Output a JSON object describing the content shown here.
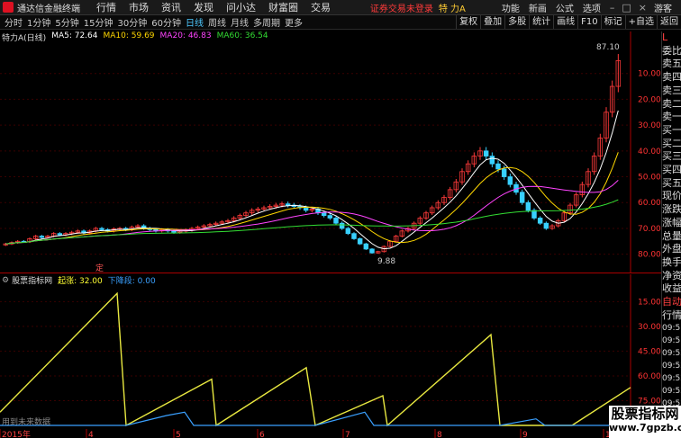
{
  "app": {
    "title": "通达信金融终端",
    "menus": [
      "行情",
      "市场",
      "资讯",
      "发现",
      "问小达",
      "财富圈",
      "交易"
    ],
    "login_status": "证券交易未登录",
    "stock_name": "特 力A",
    "right_menus": [
      "功能",
      "新画",
      "公式",
      "选项"
    ],
    "guest": "游客",
    "window_buttons": [
      "–",
      "□",
      "×"
    ]
  },
  "toolbar": {
    "periods": [
      "分时",
      "1分钟",
      "5分钟",
      "15分钟",
      "30分钟",
      "60分钟",
      "日线",
      "周线",
      "月线",
      "多周期",
      "更多"
    ],
    "active_period": "日线",
    "right_tools": [
      "复权",
      "叠加",
      "多股",
      "统计",
      "画线",
      "F10",
      "标记",
      "+自选",
      "返回"
    ]
  },
  "main_chart": {
    "title": "特力A(日线)",
    "ma": [
      {
        "label": "MA5: 72.64",
        "color": "#ffffff"
      },
      {
        "label": "MA10: 59.69",
        "color": "#ffd700"
      },
      {
        "label": "MA20: 46.83",
        "color": "#ff44ff"
      },
      {
        "label": "MA60: 36.54",
        "color": "#33dd33"
      }
    ],
    "y_ticks": [
      "80.00",
      "70.00",
      "60.00",
      "50.00",
      "40.00",
      "30.00",
      "20.00",
      "10.00"
    ],
    "high_label": "87.10",
    "low_label": "9.88",
    "marker": "定"
  },
  "indicator": {
    "name": "股票指标网",
    "line1": "起涨: 32.00",
    "line2": "下降段: 0.00",
    "y_ticks": [
      "75.00",
      "60.00",
      "45.00",
      "30.00",
      "15.00"
    ],
    "note": "用到未来数据"
  },
  "date_axis": {
    "labels": [
      "2015年",
      "4",
      "5",
      "6",
      "7",
      "8",
      "9",
      "10"
    ]
  },
  "right_panel": {
    "items": [
      "L",
      "委比",
      "卖五",
      "卖四",
      "卖三",
      "卖二",
      "卖一",
      "买一",
      "买二",
      "买三",
      "买四",
      "买五",
      "现价",
      "涨跌",
      "涨幅",
      "总量",
      "外盘",
      "换手",
      "净资",
      "收益",
      "自动",
      "行情",
      "09:51",
      "09:51",
      "09:52",
      "09:52",
      "09:52",
      "09:52",
      "09:52",
      "09:53",
      "09:53",
      "09:53"
    ]
  },
  "watermark": {
    "title": "股票指标网",
    "url": "www.7gpzb.com"
  },
  "chart_data": [
    {
      "type": "candlestick",
      "title": "特力A(日线)",
      "ylim": [
        5,
        90
      ],
      "y_ticks": [
        10,
        20,
        30,
        40,
        50,
        60,
        70,
        80
      ],
      "close": [
        14,
        14.5,
        15,
        14.8,
        16,
        17,
        16.5,
        17,
        18,
        17.5,
        18,
        18.5,
        19,
        18.2,
        19,
        20,
        19.5,
        19,
        19.8,
        20,
        19.5,
        20.5,
        21,
        20,
        19.5,
        19,
        19.5,
        19,
        18.5,
        19,
        19.3,
        20,
        20.5,
        21,
        21.5,
        22,
        22.5,
        23,
        24,
        25,
        26,
        27,
        27.5,
        28,
        28.5,
        29,
        29.5,
        29,
        28.5,
        28,
        27,
        27.5,
        26,
        25,
        24,
        22,
        20,
        18,
        16,
        14,
        12,
        10.5,
        11,
        13,
        15,
        17,
        19,
        20,
        22,
        24,
        26,
        28,
        30,
        32,
        35,
        38,
        42,
        45,
        48,
        50,
        48,
        45,
        43,
        40,
        37,
        34,
        30,
        27,
        24,
        22,
        20,
        21,
        23,
        26,
        29,
        33,
        37,
        42,
        48,
        55,
        65,
        75,
        85
      ]
    },
    {
      "type": "line",
      "title": "股票指标网",
      "ylim": [
        0,
        85
      ],
      "y_ticks": [
        15,
        30,
        45,
        60,
        75
      ],
      "series": [
        {
          "name": "起涨",
          "x": [
            0,
            130,
            140,
            235,
            240,
            340,
            350,
            425,
            430,
            545,
            555,
            625,
            635,
            700
          ],
          "values": [
            8,
            80,
            0,
            28,
            0,
            35,
            0,
            18,
            0,
            55,
            0,
            0,
            0,
            23
          ]
        },
        {
          "name": "下降段",
          "x": [
            0,
            130,
            140,
            185,
            205,
            215,
            235,
            350,
            405,
            415,
            545,
            555,
            595,
            605,
            640,
            700
          ],
          "values": [
            0,
            0,
            0,
            6,
            8,
            0,
            0,
            0,
            8,
            0,
            0,
            0,
            4,
            0,
            0,
            0
          ]
        }
      ]
    }
  ]
}
